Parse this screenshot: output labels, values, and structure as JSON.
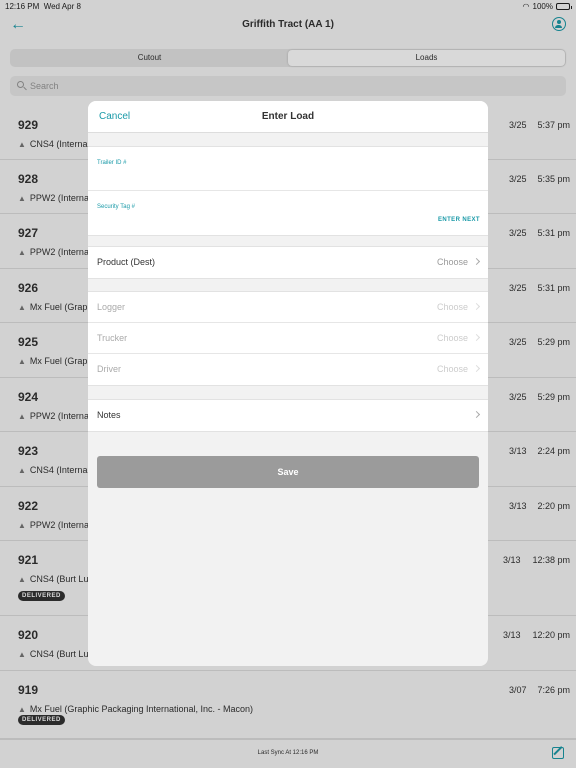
{
  "status_bar": {
    "time": "12:16 PM",
    "date": "Wed Apr 8",
    "battery": "100%"
  },
  "nav": {
    "title": "Griffith Tract (AA 1)"
  },
  "segments": [
    "Cutout",
    "Loads"
  ],
  "active_segment": "Loads",
  "search": {
    "placeholder": "Search"
  },
  "loads": [
    {
      "number": "929",
      "product": "CNS4 (Interna",
      "date": "3/25",
      "time": "5:37 pm"
    },
    {
      "number": "928",
      "product": "PPW2 (Interna",
      "date": "3/25",
      "time": "5:35 pm"
    },
    {
      "number": "927",
      "product": "PPW2 (Interna",
      "date": "3/25",
      "time": "5:31 pm"
    },
    {
      "number": "926",
      "product": "Mx Fuel (Graph",
      "date": "3/25",
      "time": "5:31 pm"
    },
    {
      "number": "925",
      "product": "Mx Fuel (Graph",
      "date": "3/25",
      "time": "5:29 pm"
    },
    {
      "number": "924",
      "product": "PPW2 (Interna",
      "date": "3/25",
      "time": "5:29 pm"
    },
    {
      "number": "923",
      "product": "CNS4 (Interna",
      "date": "3/13",
      "time": "2:24 pm"
    },
    {
      "number": "922",
      "product": "PPW2 (Interna",
      "date": "3/13",
      "time": "2:20 pm"
    },
    {
      "number": "921",
      "product": "CNS4 (Burt Lu",
      "date": "3/13",
      "time": "12:38 pm",
      "badge": "DELIVERED"
    },
    {
      "number": "920",
      "product": "CNS4 (Burt Lu",
      "date": "3/13",
      "time": "12:20 pm"
    },
    {
      "number": "919",
      "product": "Mx Fuel (Graphic Packaging International, Inc. - Macon)",
      "date": "3/07",
      "time": "7:26 pm",
      "badge": "DELIVERED"
    }
  ],
  "footer": {
    "sync": "Last Sync At 12:16 PM"
  },
  "modal": {
    "cancel": "Cancel",
    "title": "Enter Load",
    "trailer_label": "Trailer ID #",
    "trailer_value": "",
    "security_label": "Security Tag #",
    "security_value": "",
    "enter_next": "ENTER NEXT",
    "product_label": "Product (Dest)",
    "product_value": "Choose",
    "logger_label": "Logger",
    "logger_value": "Choose",
    "trucker_label": "Trucker",
    "trucker_value": "Choose",
    "driver_label": "Driver",
    "driver_value": "Choose",
    "notes_label": "Notes",
    "save": "Save"
  },
  "colors": {
    "accent": "#1a9aa8",
    "save_disabled": "#9b9b9b",
    "badge": "#333333"
  }
}
